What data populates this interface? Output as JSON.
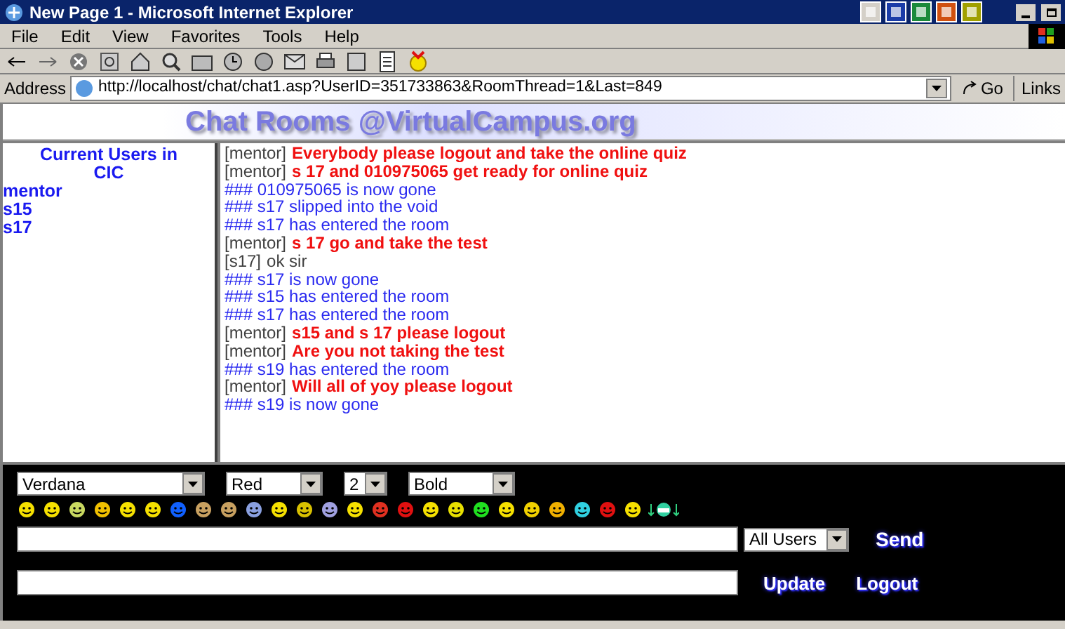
{
  "window": {
    "title": "New Page 1 - Microsoft Internet Explorer"
  },
  "menu": [
    "File",
    "Edit",
    "View",
    "Favorites",
    "Tools",
    "Help"
  ],
  "address_bar": {
    "label": "Address",
    "url": "http://localhost/chat/chat1.asp?UserID=351733863&RoomThread=1&Last=849",
    "go": "Go",
    "links": "Links"
  },
  "page_title": "Chat Rooms @VirtualCampus.org",
  "users": {
    "heading": "Current Users in CIC",
    "items": [
      "mentor",
      "s15",
      "s17"
    ]
  },
  "messages": [
    {
      "kind": "post",
      "sender": "[mentor]",
      "text": "Everybody please logout and take the online quiz",
      "highlighted": true
    },
    {
      "kind": "post",
      "sender": "[mentor]",
      "text": "s 17 and 010975065 get ready for online quiz",
      "highlighted": true
    },
    {
      "kind": "system",
      "prefix": "###",
      "text": "010975065 is now gone"
    },
    {
      "kind": "system",
      "prefix": "###",
      "text": "s17 slipped into the void"
    },
    {
      "kind": "system",
      "prefix": "###",
      "text": "s17 has entered the room"
    },
    {
      "kind": "post",
      "sender": "[mentor]",
      "text": "s 17 go and take the test",
      "highlighted": true
    },
    {
      "kind": "post",
      "sender": "[s17]",
      "text": "ok sir",
      "highlighted": false
    },
    {
      "kind": "system",
      "prefix": "###",
      "text": "s17 is now gone"
    },
    {
      "kind": "system",
      "prefix": "###",
      "text": "s15 has entered the room"
    },
    {
      "kind": "system",
      "prefix": "###",
      "text": "s17 has entered the room"
    },
    {
      "kind": "post",
      "sender": "[mentor]",
      "text": "s15 and s 17 please logout",
      "highlighted": true
    },
    {
      "kind": "post",
      "sender": "[mentor]",
      "text": "Are you not taking the test",
      "highlighted": true
    },
    {
      "kind": "system",
      "prefix": "###",
      "text": "s19 has entered the room"
    },
    {
      "kind": "post",
      "sender": "[mentor]",
      "text": "Will all of yoy please logout",
      "highlighted": true
    },
    {
      "kind": "system",
      "prefix": "###",
      "text": "s19 is now gone"
    }
  ],
  "format": {
    "font": "Verdana",
    "text_color": "Red",
    "size": "2",
    "style": "Bold"
  },
  "recipient": "All Users",
  "buttons": {
    "send": "Send",
    "update": "Update",
    "logout": "Logout"
  }
}
